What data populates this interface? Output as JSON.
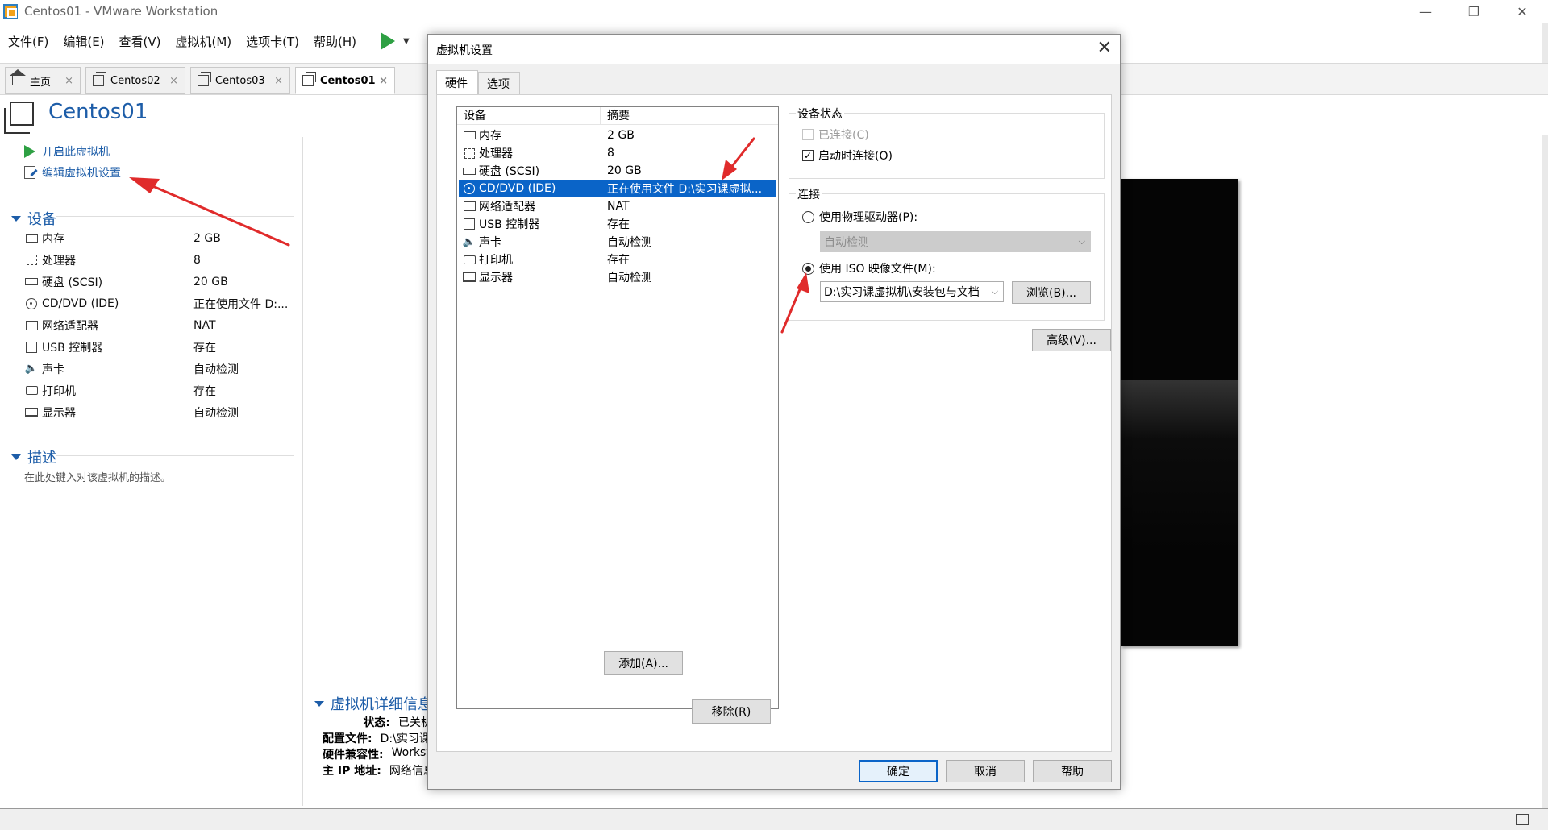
{
  "window": {
    "title": "Centos01 - VMware Workstation",
    "controls": [
      "—",
      "❐",
      "✕"
    ]
  },
  "menu": [
    "文件(F)",
    "编辑(E)",
    "查看(V)",
    "虚拟机(M)",
    "选项卡(T)",
    "帮助(H)"
  ],
  "tabs": [
    {
      "label": "主页",
      "close": "×"
    },
    {
      "label": "Centos02",
      "close": "×"
    },
    {
      "label": "Centos03",
      "close": "×"
    },
    {
      "label": "Centos01",
      "close": "×"
    }
  ],
  "vm": {
    "name": "Centos01",
    "actions": {
      "power_on": "开启此虚拟机",
      "edit_settings": "编辑虚拟机设置"
    },
    "devices_title": "设备",
    "devices": [
      {
        "name": "内存",
        "value": "2 GB"
      },
      {
        "name": "处理器",
        "value": "8"
      },
      {
        "name": "硬盘 (SCSI)",
        "value": "20 GB"
      },
      {
        "name": "CD/DVD (IDE)",
        "value": "正在使用文件 D:..."
      },
      {
        "name": "网络适配器",
        "value": "NAT"
      },
      {
        "name": "USB 控制器",
        "value": "存在"
      },
      {
        "name": "声卡",
        "value": "自动检测"
      },
      {
        "name": "打印机",
        "value": "存在"
      },
      {
        "name": "显示器",
        "value": "自动检测"
      }
    ],
    "description_title": "描述",
    "description_hint": "在此处键入对该虚拟机的描述。",
    "details_title": "虚拟机详细信息",
    "details": [
      {
        "label": "状态:",
        "value": "已关机"
      },
      {
        "label": "配置文件:",
        "value": "D:\\实习课虚拟机"
      },
      {
        "label": "硬件兼容性:",
        "value": "Workstation"
      },
      {
        "label": "主 IP 地址:",
        "value": "网络信息不可用"
      }
    ]
  },
  "dialog": {
    "title": "虚拟机设置",
    "close": "✕",
    "tabs": [
      "硬件",
      "选项"
    ],
    "list_headers": {
      "device": "设备",
      "summary": "摘要"
    },
    "devices": [
      {
        "name": "内存",
        "summary": "2 GB"
      },
      {
        "name": "处理器",
        "summary": "8"
      },
      {
        "name": "硬盘 (SCSI)",
        "summary": "20 GB"
      },
      {
        "name": "CD/DVD (IDE)",
        "summary": "正在使用文件 D:\\实习课虚拟..."
      },
      {
        "name": "网络适配器",
        "summary": "NAT"
      },
      {
        "name": "USB 控制器",
        "summary": "存在"
      },
      {
        "name": "声卡",
        "summary": "自动检测"
      },
      {
        "name": "打印机",
        "summary": "存在"
      },
      {
        "name": "显示器",
        "summary": "自动检测"
      }
    ],
    "add_button": "添加(A)...",
    "remove_button": "移除(R)",
    "device_status": {
      "title": "设备状态",
      "connected": "已连接(C)",
      "connect_at_power_on": "启动时连接(O)"
    },
    "connection": {
      "title": "连接",
      "physical_drive": "使用物理驱动器(P):",
      "physical_select": "自动检测",
      "iso_image": "使用 ISO 映像文件(M):",
      "iso_path": "D:\\实习课虚拟机\\安装包与文档",
      "browse_button": "浏览(B)..."
    },
    "advanced_button": "高级(V)...",
    "ok_button": "确定",
    "cancel_button": "取消",
    "help_button": "帮助"
  },
  "icons": {
    "check": "✓",
    "dropdown": "⌵",
    "sound": "🔈"
  },
  "colors": {
    "accent": "#1d5da8",
    "selection": "#0a64c8",
    "play": "#2ea043",
    "annotation": "#e02b2b"
  }
}
